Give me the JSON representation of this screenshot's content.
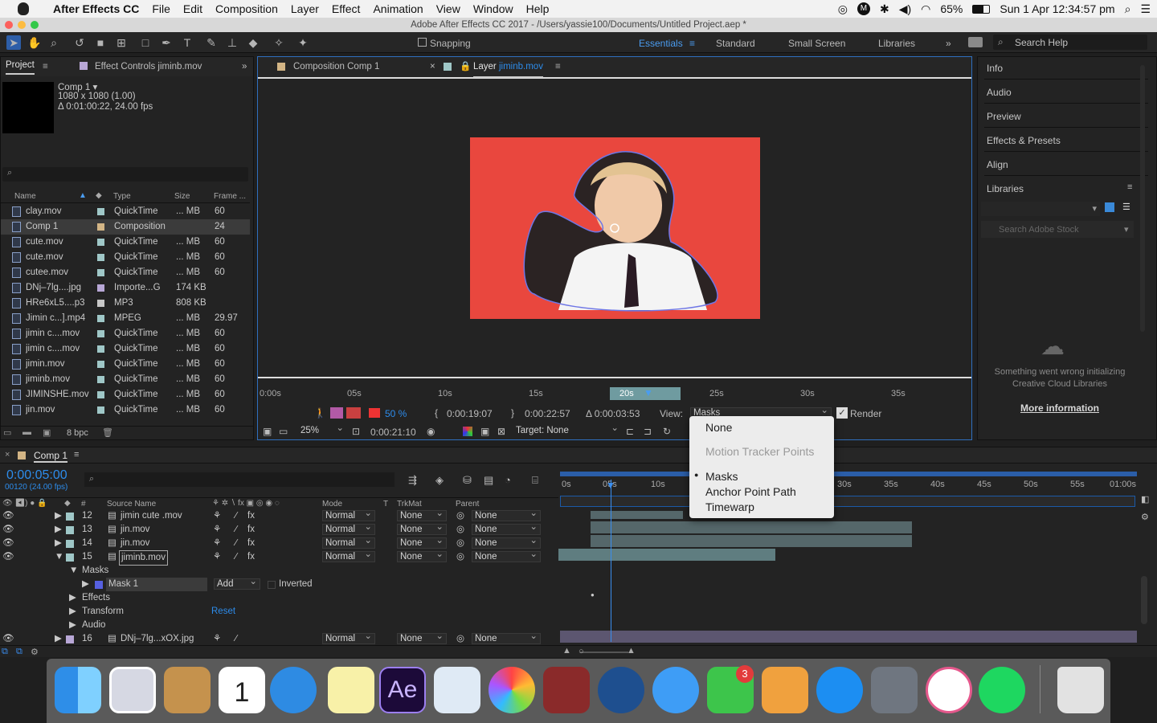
{
  "menubar": {
    "app": "After Effects CC",
    "items": [
      "File",
      "Edit",
      "Composition",
      "Layer",
      "Effect",
      "Animation",
      "View",
      "Window",
      "Help"
    ],
    "battery": "65%",
    "clock": "Sun 1 Apr 12:34:57 pm"
  },
  "window": {
    "title": "Adobe After Effects CC 2017 - /Users/yassie100/Documents/Untitled Project.aep *"
  },
  "toolbar": {
    "snapping": "Snapping",
    "workspaces": [
      "Essentials",
      "Standard",
      "Small Screen",
      "Libraries"
    ],
    "search_help": "Search Help"
  },
  "project": {
    "tab": "Project",
    "effect_controls": "Effect Controls jiminb.mov",
    "comp_name": "Comp 1 ▾",
    "comp_res": "1080 x 1080 (1.00)",
    "comp_dur": "Δ 0:01:00:22, 24.00 fps",
    "columns": [
      "Name",
      "Type",
      "Size",
      "Frame ..."
    ],
    "items": [
      {
        "name": "clay.mov",
        "type": "QuickTime",
        "size": "... MB",
        "fr": "60",
        "color": "#9fc7c7"
      },
      {
        "name": "Comp 1",
        "type": "Composition",
        "size": "",
        "fr": "24",
        "color": "#d3b585"
      },
      {
        "name": "cute.mov",
        "type": "QuickTime",
        "size": "... MB",
        "fr": "60",
        "color": "#9fc7c7"
      },
      {
        "name": "cute.mov",
        "type": "QuickTime",
        "size": "... MB",
        "fr": "60",
        "color": "#9fc7c7"
      },
      {
        "name": "cutee.mov",
        "type": "QuickTime",
        "size": "... MB",
        "fr": "60",
        "color": "#9fc7c7"
      },
      {
        "name": "DNj–7lg....jpg",
        "type": "Importe...G",
        "size": "174 KB",
        "fr": "",
        "color": "#b8a7d6"
      },
      {
        "name": "HRe6xL5....p3",
        "type": "MP3",
        "size": "808 KB",
        "fr": "",
        "color": "#c7c7c7"
      },
      {
        "name": "Jimin c...].mp4",
        "type": "MPEG",
        "size": "... MB",
        "fr": "29.97",
        "color": "#9fc7c7"
      },
      {
        "name": "jimin c....mov",
        "type": "QuickTime",
        "size": "... MB",
        "fr": "60",
        "color": "#9fc7c7"
      },
      {
        "name": "jimin c....mov",
        "type": "QuickTime",
        "size": "... MB",
        "fr": "60",
        "color": "#9fc7c7"
      },
      {
        "name": "jimin.mov",
        "type": "QuickTime",
        "size": "... MB",
        "fr": "60",
        "color": "#9fc7c7"
      },
      {
        "name": "jiminb.mov",
        "type": "QuickTime",
        "size": "... MB",
        "fr": "60",
        "color": "#9fc7c7"
      },
      {
        "name": "JIMINSHE.mov",
        "type": "QuickTime",
        "size": "... MB",
        "fr": "60",
        "color": "#9fc7c7"
      },
      {
        "name": "jin.mov",
        "type": "QuickTime",
        "size": "... MB",
        "fr": "60",
        "color": "#9fc7c7"
      }
    ],
    "bpc": "8 bpc"
  },
  "viewer": {
    "tab1": "Composition Comp 1",
    "tab2_prefix": "Layer",
    "tab2_name": "jiminb.mov",
    "ruler": [
      "0:00s",
      "05s",
      "10s",
      "15s",
      "20s",
      "25s",
      "30s",
      "35s"
    ],
    "zoom_pct": "50 %",
    "in_time": "0:00:19:07",
    "out_time": "0:00:22:57",
    "duration": "Δ 0:00:03:53",
    "view_label": "View:",
    "view_value": "Masks",
    "render": "Render",
    "zoom": "25%",
    "current": "0:00:21:10",
    "target": "Target: None"
  },
  "menu": {
    "items": [
      "None",
      "Motion Tracker Points",
      "Masks",
      "Anchor Point Path",
      "Timewarp"
    ]
  },
  "right": {
    "panels": [
      "Info",
      "Audio",
      "Preview",
      "Effects & Presets",
      "Align",
      "Libraries"
    ],
    "search_stock": "Search Adobe Stock",
    "error": "Something went wrong initializing Creative Cloud Libraries",
    "more": "More information"
  },
  "timeline": {
    "tab": "Comp 1",
    "timecode": "0:00:05:00",
    "frames": "00120 (24.00 fps)",
    "cols": [
      "#",
      "Source Name",
      "Mode",
      "T",
      "TrkMat",
      "Parent"
    ],
    "ruler": [
      "0s",
      "05s",
      "10s",
      "",
      "30s",
      "35s",
      "40s",
      "45s",
      "50s",
      "55s",
      "01:00s"
    ],
    "layers": [
      {
        "num": "12",
        "name": "jimin cute .mov",
        "mode": "Normal",
        "trk": "None",
        "parent": "None"
      },
      {
        "num": "13",
        "name": "jin.mov",
        "mode": "Normal",
        "trk": "None",
        "parent": "None"
      },
      {
        "num": "14",
        "name": "jin.mov",
        "mode": "Normal",
        "trk": "None",
        "parent": "None"
      },
      {
        "num": "15",
        "name": "jiminb.mov",
        "mode": "Normal",
        "trk": "None",
        "parent": "None"
      },
      {
        "num": "16",
        "name": "DNj–7lg...xOX.jpg",
        "mode": "Normal",
        "trk": "None",
        "parent": "None"
      }
    ],
    "masks": "Masks",
    "mask1": "Mask 1",
    "mask_mode": "Add",
    "inverted": "Inverted",
    "effects": "Effects",
    "transform": "Transform",
    "reset": "Reset",
    "audio": "Audio"
  },
  "dock": {
    "badge": "3",
    "ae": "Ae"
  }
}
